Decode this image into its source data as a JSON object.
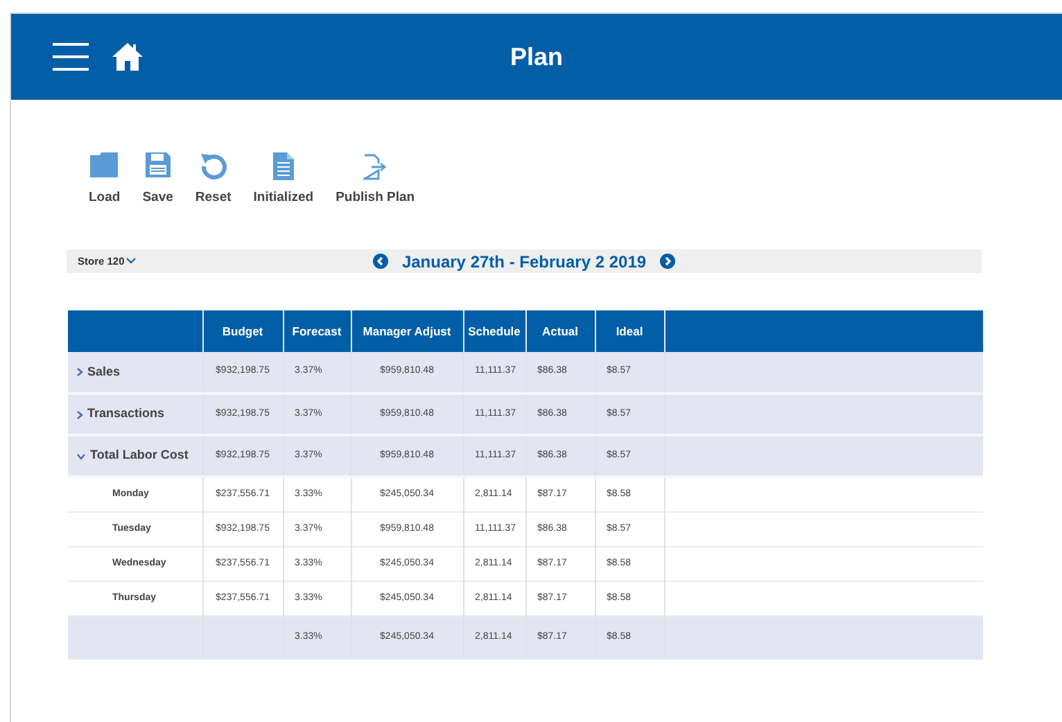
{
  "header": {
    "title": "Plan"
  },
  "toolbar": [
    {
      "kind": "load",
      "label": "Load"
    },
    {
      "kind": "save",
      "label": "Save"
    },
    {
      "kind": "reset",
      "label": "Reset"
    },
    {
      "kind": "initialized",
      "label": "Initialized"
    },
    {
      "kind": "publish",
      "label": "Publish Plan"
    }
  ],
  "store_selector": {
    "value": "Store 120"
  },
  "date_range": "January 27th - February 2 2019",
  "table": {
    "columns": [
      "Budget",
      "Forecast",
      "Manager Adjust",
      "Schedule",
      "Actual",
      "Ideal"
    ],
    "rows": [
      {
        "kind": "group",
        "label": "Sales",
        "expanded": false,
        "cells": [
          "$932,198.75",
          "3.37%",
          "$959,810.48",
          "11,111.37",
          "$86.38",
          "$8.57"
        ]
      },
      {
        "kind": "group",
        "label": "Transactions",
        "expanded": false,
        "cells": [
          "$932,198.75",
          "3.37%",
          "$959,810.48",
          "11,111.37",
          "$86.38",
          "$8.57"
        ]
      },
      {
        "kind": "group",
        "label": "Total Labor Cost",
        "expanded": true,
        "cells": [
          "$932,198.75",
          "3.37%",
          "$959,810.48",
          "11,111.37",
          "$86.38",
          "$8.57"
        ]
      },
      {
        "kind": "day",
        "label": "Monday",
        "cells": [
          "$237,556.71",
          "3.33%",
          "$245,050.34",
          "2,811.14",
          "$87.17",
          "$8.58"
        ]
      },
      {
        "kind": "day",
        "label": "Tuesday",
        "cells": [
          "$932,198.75",
          "3.37%",
          "$959,810.48",
          "11,111.37",
          "$86.38",
          "$8.57"
        ]
      },
      {
        "kind": "day",
        "label": "Wednesday",
        "cells": [
          "$237,556.71",
          "3.33%",
          "$245,050.34",
          "2,811.14",
          "$87.17",
          "$8.58"
        ]
      },
      {
        "kind": "day",
        "label": "Thursday",
        "cells": [
          "$237,556.71",
          "3.33%",
          "$245,050.34",
          "2,811.14",
          "$87.17",
          "$8.58"
        ]
      },
      {
        "kind": "total",
        "cells": [
          "",
          "3.33%",
          "$245,050.34",
          "2,811.14",
          "$87.17",
          "$8.58"
        ]
      }
    ]
  }
}
